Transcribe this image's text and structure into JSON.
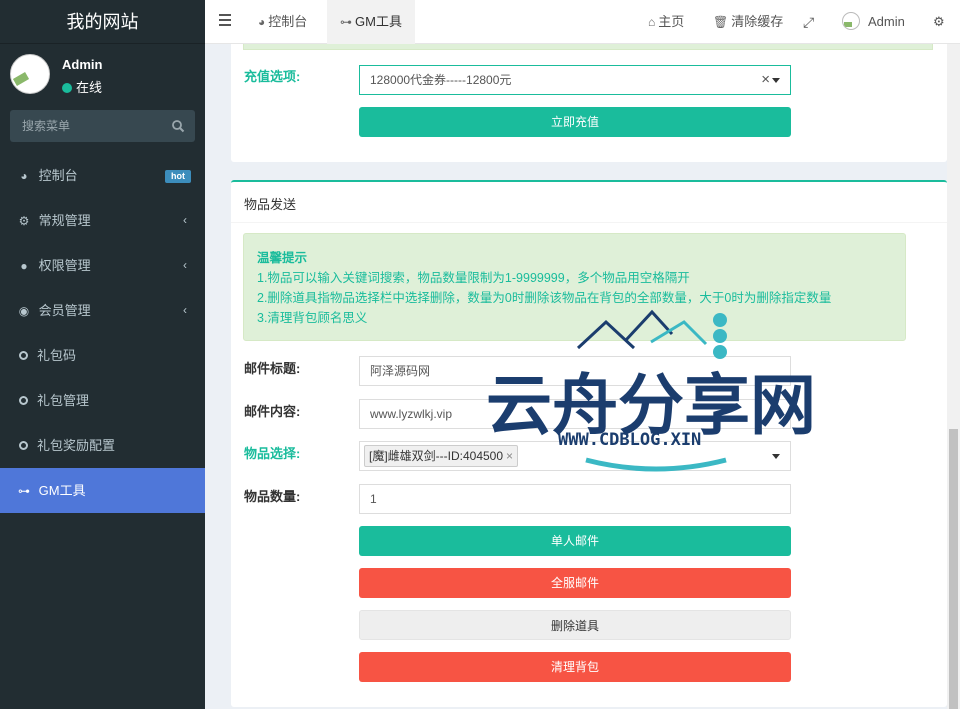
{
  "sidebar": {
    "logo": "我的网站",
    "user": {
      "name": "Admin",
      "status": "在线"
    },
    "search": {
      "placeholder": "搜索菜单"
    },
    "items": [
      {
        "label": "控制台",
        "icon": "dashboard-icon",
        "badge": "hot"
      },
      {
        "label": "常规管理",
        "icon": "cogs-icon"
      },
      {
        "label": "权限管理",
        "icon": "users-icon"
      },
      {
        "label": "会员管理",
        "icon": "user-circle-icon"
      },
      {
        "label": "礼包码",
        "icon": "circle-icon"
      },
      {
        "label": "礼包管理",
        "icon": "circle-icon"
      },
      {
        "label": "礼包奖励配置",
        "icon": "circle-icon"
      },
      {
        "label": "GM工具",
        "icon": "gamepad-icon"
      }
    ]
  },
  "header": {
    "tabs": [
      {
        "label": "控制台",
        "icon": "dashboard-icon"
      },
      {
        "label": "GM工具",
        "icon": "gamepad-icon"
      }
    ],
    "right": {
      "home": "主页",
      "clear_cache": "清除缓存",
      "user": "Admin"
    }
  },
  "recharge": {
    "label": "充值选项:",
    "selected": "128000代金券-----12800元",
    "submit": "立即充值"
  },
  "send_items": {
    "title": "物品发送",
    "tips": {
      "title": "温馨提示",
      "lines": [
        "1.物品可以输入关键词搜索，物品数量限制为1-9999999，多个物品用空格隔开",
        "2.删除道具指物品选择栏中选择删除，数量为0时删除该物品在背包的全部数量，大于0时为删除指定数量",
        "3.清理背包顾名思义"
      ]
    },
    "mail_title": {
      "label": "邮件标题:",
      "value": "阿泽源码网"
    },
    "mail_content": {
      "label": "邮件内容:",
      "value": "www.lyzwlkj.vip"
    },
    "item_select": {
      "label": "物品选择:",
      "tag": "[魔]雌雄双剑---ID:404500"
    },
    "item_count": {
      "label": "物品数量:",
      "value": "1"
    },
    "buttons": {
      "single": "单人邮件",
      "all": "全服邮件",
      "delete": "删除道具",
      "clear": "清理背包"
    }
  },
  "watermark": {
    "brand": "云舟分享网",
    "url": "WWW.CDBLOG.XIN"
  },
  "colors": {
    "accent": "#1abc9c",
    "danger": "#f75444",
    "sidebar": "#222d32",
    "active": "#4f77d9",
    "watermark_navy": "#1b3d6e"
  }
}
